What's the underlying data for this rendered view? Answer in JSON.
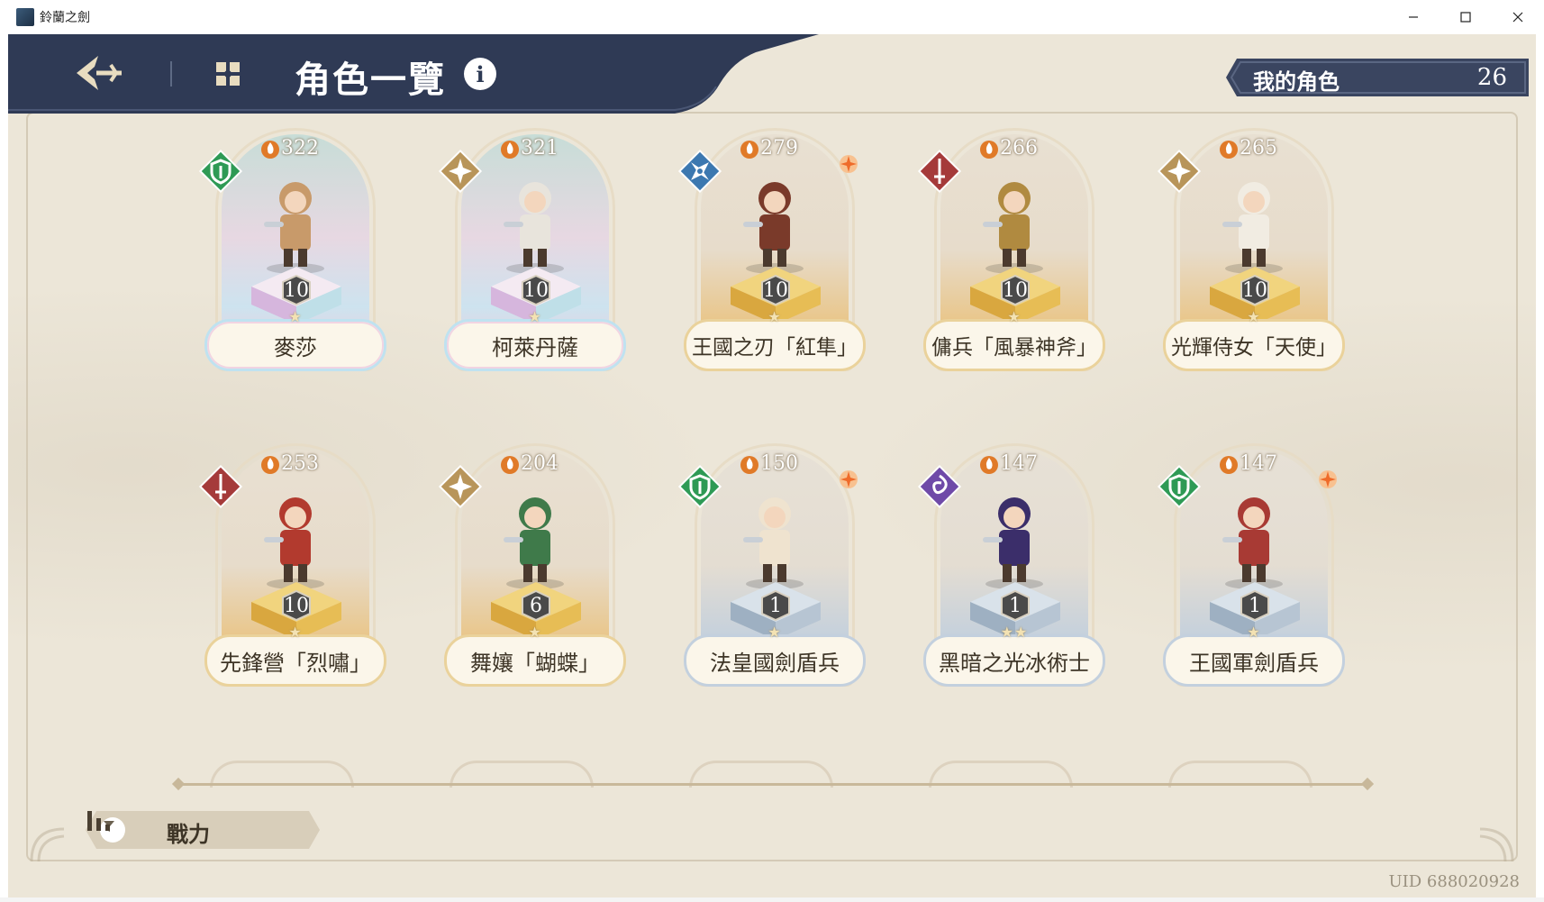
{
  "window": {
    "title": "鈴蘭之劍"
  },
  "header": {
    "title": "角色一覽",
    "info_glyph": "i",
    "my_characters_label": "我的角色",
    "my_characters_count": "26"
  },
  "characters": [
    {
      "name": "麥莎",
      "power": "322",
      "level": "10",
      "stars": "★",
      "frame": "rainbow",
      "class": "shield",
      "new": false
    },
    {
      "name": "柯萊丹薩",
      "power": "321",
      "level": "10",
      "stars": "★",
      "frame": "rainbow",
      "class": "star",
      "new": false
    },
    {
      "name": "王國之刃「紅隼」",
      "power": "279",
      "level": "10",
      "stars": "★",
      "frame": "gold",
      "class": "shuriken",
      "new": true
    },
    {
      "name": "傭兵「風暴神斧」",
      "power": "266",
      "level": "10",
      "stars": "★",
      "frame": "gold",
      "class": "sword",
      "new": false
    },
    {
      "name": "光輝侍女「天使」",
      "power": "265",
      "level": "10",
      "stars": "★",
      "frame": "gold",
      "class": "star",
      "new": false
    },
    {
      "name": "先鋒營「烈嘯」",
      "power": "253",
      "level": "10",
      "stars": "★",
      "frame": "gold",
      "class": "sword",
      "new": false
    },
    {
      "name": "舞孃「蝴蝶」",
      "power": "204",
      "level": "6",
      "stars": "★",
      "frame": "gold",
      "class": "star",
      "new": false
    },
    {
      "name": "法皇國劍盾兵",
      "power": "150",
      "level": "1",
      "stars": "★",
      "frame": "blue",
      "class": "shield",
      "new": true
    },
    {
      "name": "黑暗之光冰術士",
      "power": "147",
      "level": "1",
      "stars": "★★",
      "frame": "blue",
      "class": "magic",
      "new": false
    },
    {
      "name": "王國軍劍盾兵",
      "power": "147",
      "level": "1",
      "stars": "★",
      "frame": "blue",
      "class": "shield",
      "new": true
    }
  ],
  "sort": {
    "label": "戰力"
  },
  "footer": {
    "uid": "UID 688020928"
  },
  "colors": {
    "header_navy": "#2f3a55",
    "parchment": "#ece6d8",
    "class_shield": "#2e9a55",
    "class_star": "#b8955a",
    "class_shuriken": "#3c78b0",
    "class_sword": "#a53a3a",
    "class_magic": "#6f4aa8"
  }
}
